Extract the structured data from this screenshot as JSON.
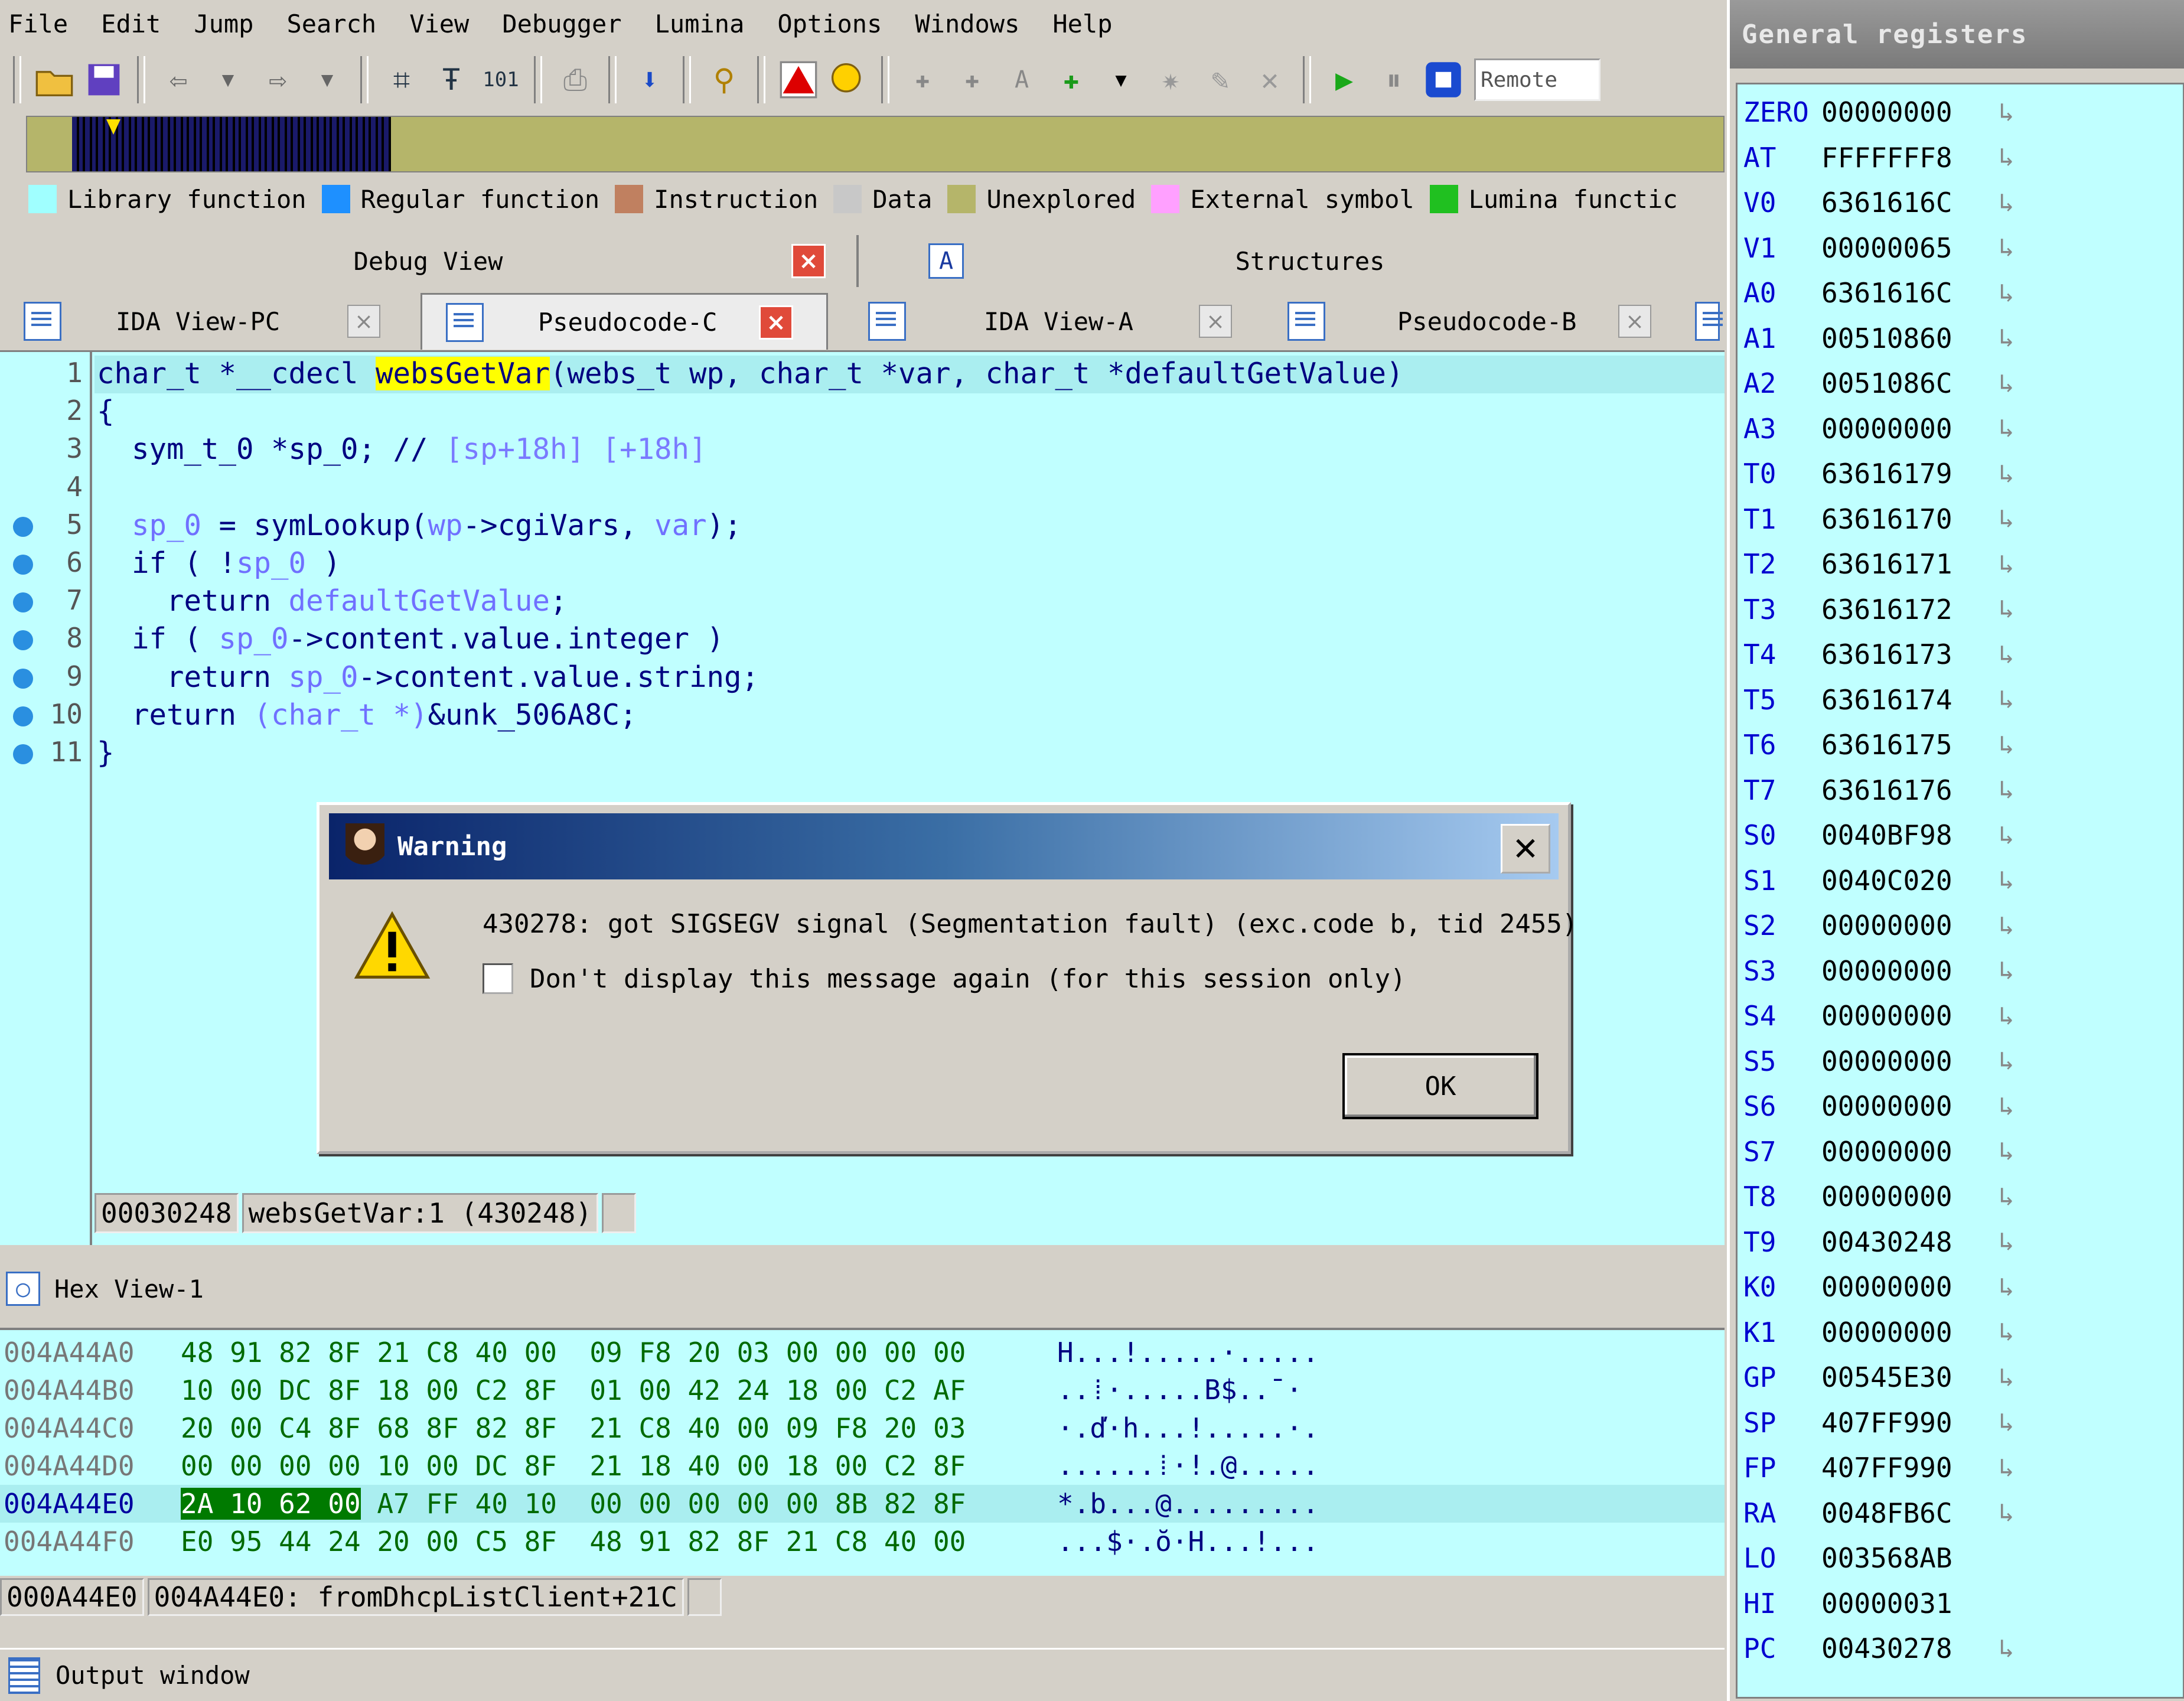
{
  "menu": [
    "File",
    "Edit",
    "Jump",
    "Search",
    "View",
    "Debugger",
    "Lumina",
    "Options",
    "Windows",
    "Help"
  ],
  "toolbar": {
    "remote_label": "Remote"
  },
  "legend": [
    {
      "label": "Library function",
      "color": "#a0ffff"
    },
    {
      "label": "Regular function",
      "color": "#1e90ff"
    },
    {
      "label": "Instruction",
      "color": "#c08060"
    },
    {
      "label": "Data",
      "color": "#c8c8c8"
    },
    {
      "label": "Unexplored",
      "color": "#b5b56a"
    },
    {
      "label": "External symbol",
      "color": "#ffa0ff"
    },
    {
      "label": "Lumina functic",
      "color": "#20c020"
    }
  ],
  "panels": {
    "debug_view": "Debug View",
    "structures": "Structures"
  },
  "subtabs": [
    "IDA View-PC",
    "Pseudocode-C",
    "IDA View-A",
    "Pseudocode-B"
  ],
  "code": {
    "line_numbers": [
      "1",
      "2",
      "3",
      "4",
      "5",
      "6",
      "7",
      "8",
      "9",
      "10",
      "11"
    ],
    "line1": {
      "ret": "char_t *__cdecl ",
      "fn": "websGetVar",
      "args": "(webs_t wp, char_t *var, char_t *defaultGetValue)"
    },
    "line2": "{",
    "line3": {
      "decl": "  sym_t_0 *sp_0; // ",
      "cmt": "[sp+18h] [+18h]"
    },
    "line5": {
      "a": "  ",
      "v1": "sp_0",
      "b": " = symLookup(",
      "v2": "wp",
      "c": "->cgiVars, ",
      "v3": "var",
      "d": ");"
    },
    "line6": {
      "a": "  if ( !",
      "v": "sp_0",
      "b": " )"
    },
    "line7": {
      "a": "    return ",
      "v": "defaultGetValue",
      "b": ";"
    },
    "line8": {
      "a": "  if ( ",
      "v": "sp_0",
      "b": "->content.value.integer )"
    },
    "line9": {
      "a": "    return ",
      "v": "sp_0",
      "b": "->content.value.string;"
    },
    "line10": {
      "a": "  return ",
      "v": "(char_t *)",
      "b": "&unk_506A8C;"
    },
    "line11": "}",
    "status": [
      "00030248",
      "websGetVar:1 (430248)"
    ]
  },
  "hex": {
    "title": "Hex View-1",
    "rows": [
      {
        "addr": "004A44A0",
        "bytes": "48 91 82 8F 21 C8 40 00  09 F8 20 03 00 00 00 00",
        "ascii": "H...!.....·....."
      },
      {
        "addr": "004A44B0",
        "bytes": "10 00 DC 8F 18 00 C2 8F  01 00 42 24 18 00 C2 AF",
        "ascii": "..⁞·.....B$..¯·"
      },
      {
        "addr": "004A44C0",
        "bytes": "20 00 C4 8F 68 8F 82 8F  21 C8 40 00 09 F8 20 03",
        "ascii": "·.ď·h...!.....·."
      },
      {
        "addr": "004A44D0",
        "bytes": "00 00 00 00 10 00 DC 8F  21 18 40 00 18 00 C2 8F",
        "ascii": "......⁞·!.@....."
      },
      {
        "addr": "004A44E0",
        "sel": "2A 10 62 00",
        "bytes_rest": " A7 FF 40 10  00 00 00 00 00 8B 82 8F",
        "ascii": "*.b...@........."
      },
      {
        "addr": "004A44F0",
        "bytes": "E0 95 44 24 20 00 C5 8F  48 91 82 8F 21 C8 40 00",
        "ascii": "...$·.ŏ·H...!..."
      }
    ],
    "status": [
      "000A44E0",
      "004A44E0: fromDhcpListClient+21C"
    ]
  },
  "output": {
    "title": "Output window"
  },
  "registers": {
    "title": "General registers",
    "items": [
      {
        "name": "ZERO",
        "value": "00000000",
        "arrow": true
      },
      {
        "name": "AT",
        "value": "FFFFFFF8",
        "arrow": true
      },
      {
        "name": "V0",
        "value": "6361616C",
        "arrow": true
      },
      {
        "name": "V1",
        "value": "00000065",
        "arrow": true
      },
      {
        "name": "A0",
        "value": "6361616C",
        "arrow": true
      },
      {
        "name": "A1",
        "value": "00510860",
        "arrow": true
      },
      {
        "name": "A2",
        "value": "0051086C",
        "arrow": true
      },
      {
        "name": "A3",
        "value": "00000000",
        "arrow": true
      },
      {
        "name": "T0",
        "value": "63616179",
        "arrow": true
      },
      {
        "name": "T1",
        "value": "63616170",
        "arrow": true
      },
      {
        "name": "T2",
        "value": "63616171",
        "arrow": true
      },
      {
        "name": "T3",
        "value": "63616172",
        "arrow": true
      },
      {
        "name": "T4",
        "value": "63616173",
        "arrow": true
      },
      {
        "name": "T5",
        "value": "63616174",
        "arrow": true
      },
      {
        "name": "T6",
        "value": "63616175",
        "arrow": true
      },
      {
        "name": "T7",
        "value": "63616176",
        "arrow": true
      },
      {
        "name": "S0",
        "value": "0040BF98",
        "arrow": true
      },
      {
        "name": "S1",
        "value": "0040C020",
        "arrow": true
      },
      {
        "name": "S2",
        "value": "00000000",
        "arrow": true
      },
      {
        "name": "S3",
        "value": "00000000",
        "arrow": true
      },
      {
        "name": "S4",
        "value": "00000000",
        "arrow": true
      },
      {
        "name": "S5",
        "value": "00000000",
        "arrow": true
      },
      {
        "name": "S6",
        "value": "00000000",
        "arrow": true
      },
      {
        "name": "S7",
        "value": "00000000",
        "arrow": true
      },
      {
        "name": "T8",
        "value": "00000000",
        "arrow": true
      },
      {
        "name": "T9",
        "value": "00430248",
        "arrow": true
      },
      {
        "name": "K0",
        "value": "00000000",
        "arrow": true
      },
      {
        "name": "K1",
        "value": "00000000",
        "arrow": true
      },
      {
        "name": "GP",
        "value": "00545E30",
        "arrow": true
      },
      {
        "name": "SP",
        "value": "407FF990",
        "arrow": true
      },
      {
        "name": "FP",
        "value": "407FF990",
        "arrow": true
      },
      {
        "name": "RA",
        "value": "0048FB6C",
        "arrow": true
      },
      {
        "name": "LO",
        "value": "003568AB",
        "arrow": false
      },
      {
        "name": "HI",
        "value": "00000031",
        "arrow": false
      },
      {
        "name": "PC",
        "value": "00430278",
        "arrow": true
      }
    ]
  },
  "dialog": {
    "title": "Warning",
    "message": "430278: got SIGSEGV signal (Segmentation fault) (exc.code b, tid 2455)",
    "checkbox": "Don't display this message again (for this session only)",
    "ok": "OK"
  }
}
